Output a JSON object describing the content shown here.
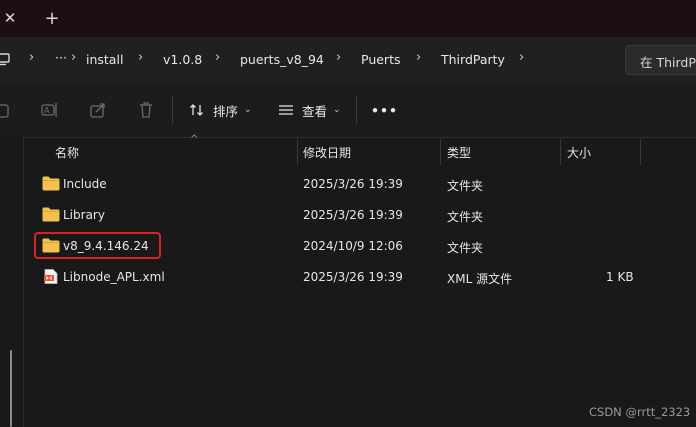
{
  "titlebar": {
    "close_glyph": "✕",
    "newtab_glyph": "+"
  },
  "breadcrumb": {
    "items": [
      "install",
      "v1.0.8",
      "puerts_v8_94",
      "Puerts",
      "ThirdParty"
    ],
    "more": "···",
    "separator": "›"
  },
  "search": {
    "placeholder": "在 ThirdParty"
  },
  "toolbar": {
    "sort_label": "排序",
    "view_label": "查看",
    "more": "•••"
  },
  "columns": {
    "name": "名称",
    "modified": "修改日期",
    "type": "类型",
    "size": "大小"
  },
  "files": [
    {
      "name": "Include",
      "modified": "2025/3/26 19:39",
      "type": "文件夹",
      "size": "",
      "icon": "folder-icon"
    },
    {
      "name": "Library",
      "modified": "2025/3/26 19:39",
      "type": "文件夹",
      "size": "",
      "icon": "folder-icon"
    },
    {
      "name": "v8_9.4.146.24",
      "modified": "2024/10/9 12:06",
      "type": "文件夹",
      "size": "",
      "icon": "folder-icon"
    },
    {
      "name": "Libnode_APL.xml",
      "modified": "2025/3/26 19:39",
      "type": "XML 源文件",
      "size": "1 KB",
      "icon": "xml-file-icon"
    }
  ],
  "colors": {
    "folder": "#f2c14e",
    "highlight": "#e02020",
    "titlebar": "#1f0d15"
  },
  "watermark": "CSDN @rrtt_2323"
}
